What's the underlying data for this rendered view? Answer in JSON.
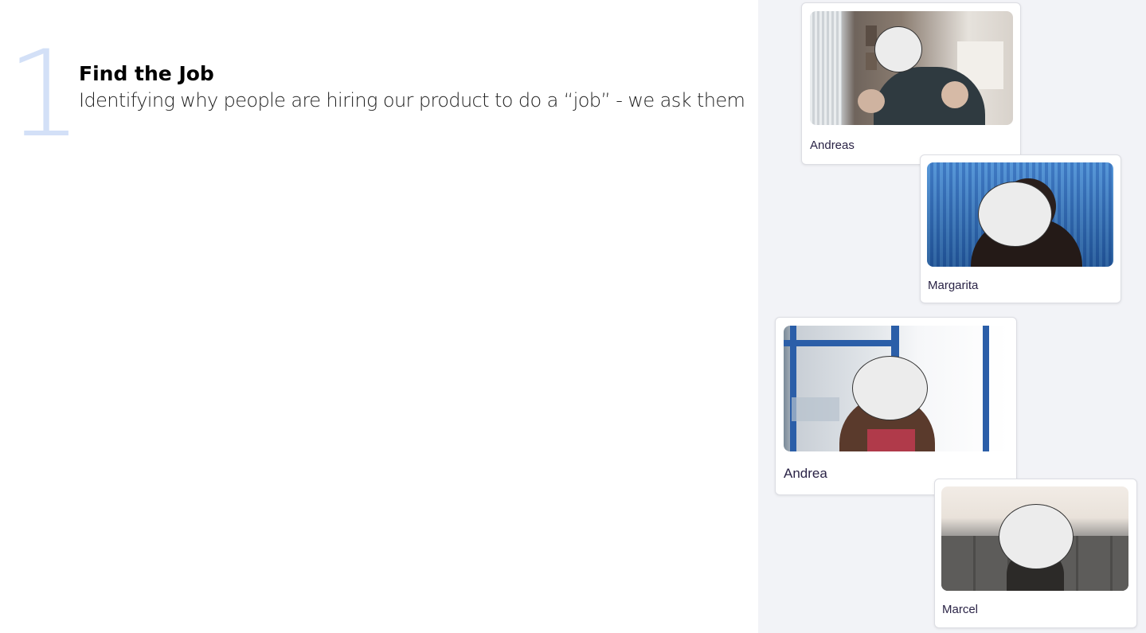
{
  "slide": {
    "step_number": "1",
    "title": "Find the Job",
    "description": "Identifying why people are hiring our product to do a “job” - we ask them"
  },
  "participants": [
    {
      "name": "Andreas"
    },
    {
      "name": "Margarita"
    },
    {
      "name": "Andrea"
    },
    {
      "name": "Marcel"
    }
  ],
  "colors": {
    "step_number": "#d3e0f7",
    "panel_background": "#f2f3f7",
    "name_text": "#2a2346"
  }
}
